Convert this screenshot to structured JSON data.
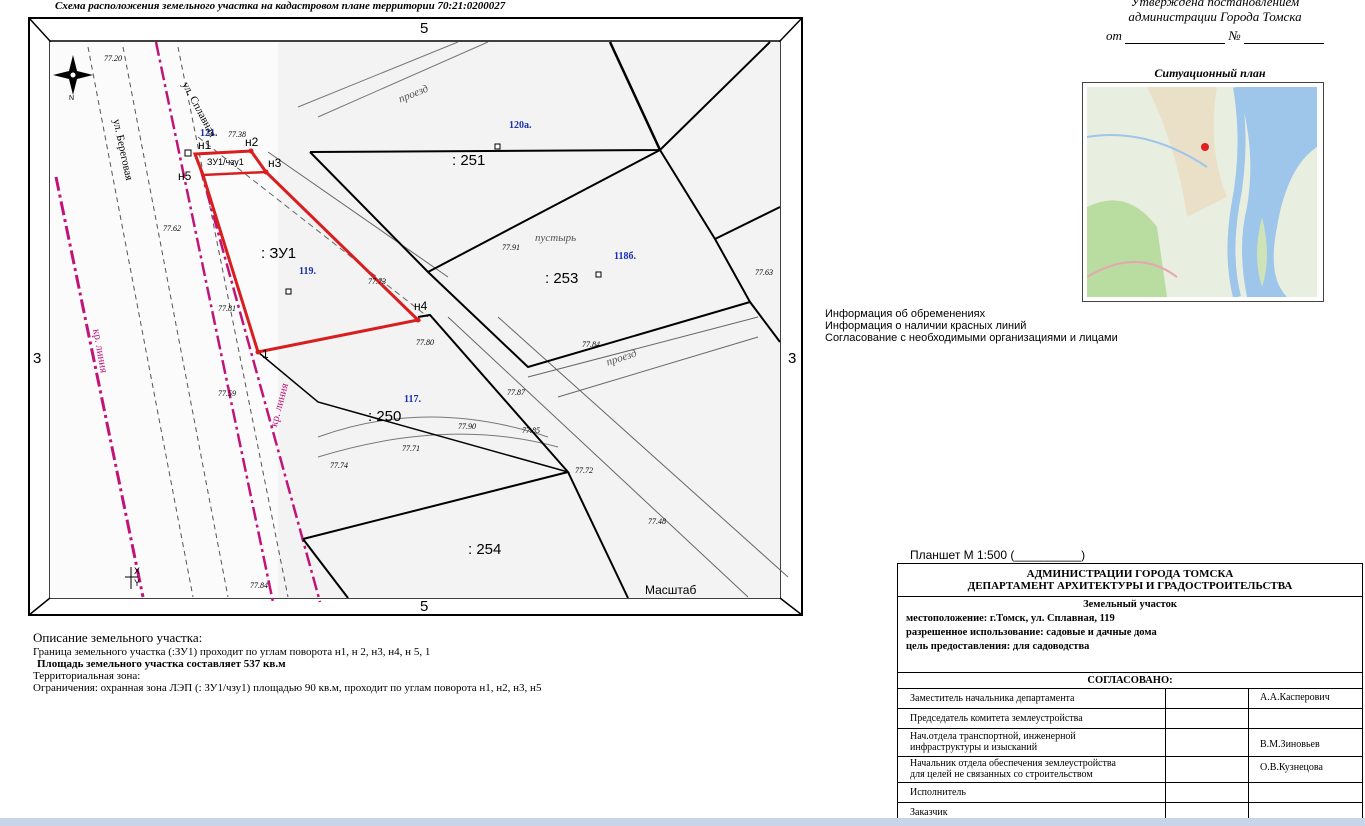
{
  "header": {
    "title": "Схема расположения земельного участка на кадастровом плане территории 70:21:0200027",
    "approved_line1": "Утверждена постановлением",
    "approved_line2": "администрации Города Томска",
    "approved_from": "от",
    "approved_no": "№"
  },
  "situational": {
    "title": "Ситуационный план"
  },
  "info": {
    "line1": "Информация об обременениях",
    "line2": "Информация о наличии красных линий",
    "line3": "Согласование с необходимыми организациями и лицами"
  },
  "map": {
    "frame_top": "5",
    "frame_bottom": "5",
    "frame_left": "3",
    "frame_right": "3",
    "parcels": [
      ": 251",
      ": 253",
      ": 250",
      ": 254"
    ],
    "lot_label": ": ЗУ1",
    "zone_label": "ЗУ1/чзу1",
    "blue_labels": [
      "121.",
      "120а.",
      "118б.",
      "119.",
      "117."
    ],
    "points": [
      "н1",
      "н2",
      "н3",
      "н4",
      "н5",
      "1"
    ],
    "streets": [
      "ул. Сплавная",
      "ул. Береговая",
      "проезд",
      "проезд",
      "пустырь",
      "кр. линия",
      "кр. линия"
    ],
    "heights": [
      "77.20",
      "77.38",
      "77.62",
      "77.81",
      "77.91",
      "77.63",
      "77.73",
      "77.80",
      "77.84",
      "77.87",
      "77.90",
      "77.71",
      "77.74",
      "77.72",
      "77.48",
      "77.59",
      "77.84",
      "77.85"
    ],
    "scale": "Масштаб",
    "north": "N",
    "axis_x": "X",
    "axis_y": "Y"
  },
  "description": {
    "heading": "Описание земельного участка:",
    "border": "Граница земельного участка (:ЗУ1) проходит по углам поворота  н1, н 2, н3, н4, н 5, 1",
    "area": "Площадь земельного участка составляет 537 кв.м",
    "zone": "Территориальная зона:",
    "restrictions": "Ограничения: охранная зона ЛЭП (: ЗУ1/чзу1) площадью 90 кв.м, проходит по углам поворота н1, н2, н3, н5"
  },
  "planshet": "Планшет М 1:500 (__________)",
  "stamp": {
    "org_line1": "АДМИНИСТРАЦИИ ГОРОДА ТОМСКА",
    "org_line2": "ДЕПАРТАМЕНТ АРХИТЕКТУРЫ И ГРАДОСТРОИТЕЛЬСТВА",
    "parcel_heading": "Земельный участок",
    "location": "местоположение: г.Томск, ул. Сплавная, 119",
    "permitted_use": "разрешенное использование: садовые и дачные дома",
    "purpose": "цель предоставления: для садоводства",
    "agreed": "СОГЛАСОВАНО:",
    "rows": [
      {
        "role": "Заместитель начальника департамента",
        "name": "А.А.Касперович"
      },
      {
        "role": "Председатель комитета землеустройства",
        "name": ""
      },
      {
        "role": "Нач.отдела транспортной, инженерной|инфраструктуры и изысканий",
        "name": "В.М.Зиновьев"
      },
      {
        "role": "Начальник отдела обеспечения землеустройства|для целей не связанных со строительством",
        "name": "О.В.Кузнецова"
      },
      {
        "role": "Исполнитель",
        "name": ""
      },
      {
        "role": "Заказчик",
        "name": ""
      }
    ]
  },
  "colors": {
    "parcel_red": "#d81e1e",
    "red_line": "#c0147a",
    "label_blue": "#1a2fb0"
  }
}
